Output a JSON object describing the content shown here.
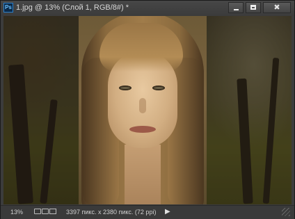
{
  "window": {
    "app_icon_text": "Ps",
    "title": "1.jpg @ 13% (Слой 1, RGB/8#) *",
    "controls": {
      "minimize": "minimize",
      "maximize": "maximize",
      "close": "✖"
    }
  },
  "canvas": {
    "description_icon": "photo-canvas"
  },
  "status": {
    "zoom": "13%",
    "doc_info": "3397 пикс. x 2380 пикс. (72 ppi)",
    "menu_arrow": "▶"
  }
}
